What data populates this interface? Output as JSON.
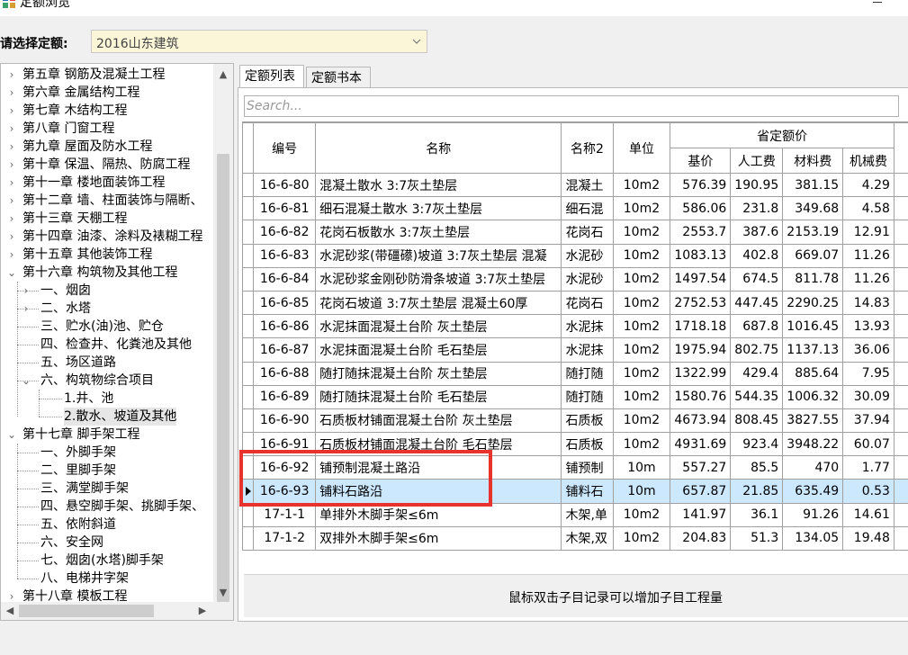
{
  "window": {
    "title": "定额浏览"
  },
  "selector": {
    "label": "请选择定额:",
    "value": "2016山东建筑"
  },
  "tree": [
    {
      "label": "第五章 钢筋及混凝土工程",
      "level": 0,
      "expander": "›"
    },
    {
      "label": "第六章 金属结构工程",
      "level": 0,
      "expander": "›"
    },
    {
      "label": "第七章 木结构工程",
      "level": 0,
      "expander": "›"
    },
    {
      "label": "第八章 门窗工程",
      "level": 0,
      "expander": "›"
    },
    {
      "label": "第九章 屋面及防水工程",
      "level": 0,
      "expander": "›"
    },
    {
      "label": "第十章 保温、隔热、防腐工程",
      "level": 0,
      "expander": "›"
    },
    {
      "label": "第十一章 楼地面装饰工程",
      "level": 0,
      "expander": "›"
    },
    {
      "label": "第十二章 墙、柱面装饰与隔断、",
      "level": 0,
      "expander": "›"
    },
    {
      "label": "第十三章 天棚工程",
      "level": 0,
      "expander": "›"
    },
    {
      "label": "第十四章 油漆、涂料及裱糊工程",
      "level": 0,
      "expander": "›"
    },
    {
      "label": "第十五章 其他装饰工程",
      "level": 0,
      "expander": "›"
    },
    {
      "label": "第十六章 构筑物及其他工程",
      "level": 0,
      "expander": "⌄"
    },
    {
      "label": "一、烟囱",
      "level": 1,
      "expander": "›"
    },
    {
      "label": "二、水塔",
      "level": 1,
      "expander": "›"
    },
    {
      "label": "三、贮水(油)池、贮仓",
      "level": 1,
      "expander": ""
    },
    {
      "label": "四、检查井、化粪池及其他",
      "level": 1,
      "expander": ""
    },
    {
      "label": "五、场区道路",
      "level": 1,
      "expander": ""
    },
    {
      "label": "六、构筑物综合项目",
      "level": 1,
      "expander": "⌄"
    },
    {
      "label": "1.井、池",
      "level": 2,
      "expander": ""
    },
    {
      "label": "2.散水、坡道及其他",
      "level": 2,
      "expander": "",
      "selected": true
    },
    {
      "label": "第十七章 脚手架工程",
      "level": 0,
      "expander": "⌄"
    },
    {
      "label": "一、外脚手架",
      "level": 1,
      "expander": ""
    },
    {
      "label": "二、里脚手架",
      "level": 1,
      "expander": ""
    },
    {
      "label": "三、满堂脚手架",
      "level": 1,
      "expander": ""
    },
    {
      "label": "四、悬空脚手架、挑脚手架、",
      "level": 1,
      "expander": ""
    },
    {
      "label": "五、依附斜道",
      "level": 1,
      "expander": ""
    },
    {
      "label": "六、安全网",
      "level": 1,
      "expander": ""
    },
    {
      "label": "七、烟囱(水塔)脚手架",
      "level": 1,
      "expander": ""
    },
    {
      "label": "八、电梯井字架",
      "level": 1,
      "expander": ""
    },
    {
      "label": "第十八章 模板工程",
      "level": 0,
      "expander": "›"
    }
  ],
  "tabs": [
    {
      "label": "定额列表",
      "active": true
    },
    {
      "label": "定额书本",
      "active": false
    }
  ],
  "search": {
    "placeholder": "Search..."
  },
  "table": {
    "headers": {
      "code": "编号",
      "name": "名称",
      "name2": "名称2",
      "unit": "单位",
      "group": "省定额价",
      "base": "基价",
      "labor": "人工费",
      "material": "材料费",
      "machine": "机械费"
    },
    "rows": [
      {
        "code": "16-6-80",
        "name": "混凝土散水 3:7灰土垫层",
        "name2": "混凝土",
        "unit": "10m2",
        "base": "576.39",
        "labor": "190.95",
        "material": "381.15",
        "machine": "4.29"
      },
      {
        "code": "16-6-81",
        "name": "细石混凝土散水 3:7灰土垫层",
        "name2": "细石混",
        "unit": "10m2",
        "base": "586.06",
        "labor": "231.8",
        "material": "349.68",
        "machine": "4.58"
      },
      {
        "code": "16-6-82",
        "name": "花岗石板散水 3:7灰土垫层",
        "name2": "花岗石",
        "unit": "10m2",
        "base": "2553.7",
        "labor": "387.6",
        "material": "2153.19",
        "machine": "12.91"
      },
      {
        "code": "16-6-83",
        "name": "水泥砂浆(带礓礤)坡道 3:7灰土垫层 混凝",
        "name2": "水泥砂",
        "unit": "10m2",
        "base": "1083.13",
        "labor": "402.8",
        "material": "669.07",
        "machine": "11.26"
      },
      {
        "code": "16-6-84",
        "name": "水泥砂浆金刚砂防滑条坡道 3:7灰土垫层",
        "name2": "水泥砂",
        "unit": "10m2",
        "base": "1497.54",
        "labor": "674.5",
        "material": "811.78",
        "machine": "11.26"
      },
      {
        "code": "16-6-85",
        "name": "花岗石坡道 3:7灰土垫层 混凝土60厚",
        "name2": "花岗石",
        "unit": "10m2",
        "base": "2752.53",
        "labor": "447.45",
        "material": "2290.25",
        "machine": "14.83"
      },
      {
        "code": "16-6-86",
        "name": "水泥抹面混凝土台阶 灰土垫层",
        "name2": "水泥抹",
        "unit": "10m2",
        "base": "1718.18",
        "labor": "687.8",
        "material": "1016.45",
        "machine": "13.93"
      },
      {
        "code": "16-6-87",
        "name": "水泥抹面混凝土台阶 毛石垫层",
        "name2": "水泥抹",
        "unit": "10m2",
        "base": "1975.94",
        "labor": "802.75",
        "material": "1137.13",
        "machine": "36.06"
      },
      {
        "code": "16-6-88",
        "name": "随打随抹混凝土台阶 灰土垫层",
        "name2": "随打随",
        "unit": "10m2",
        "base": "1322.99",
        "labor": "429.4",
        "material": "885.64",
        "machine": "7.95"
      },
      {
        "code": "16-6-89",
        "name": "随打随抹混凝土台阶 毛石垫层",
        "name2": "随打随",
        "unit": "10m2",
        "base": "1580.76",
        "labor": "544.35",
        "material": "1006.32",
        "machine": "30.09"
      },
      {
        "code": "16-6-90",
        "name": "石质板材铺面混凝土台阶 灰土垫层",
        "name2": "石质板",
        "unit": "10m2",
        "base": "4673.94",
        "labor": "808.45",
        "material": "3827.55",
        "machine": "37.94"
      },
      {
        "code": "16-6-91",
        "name": "石质板材铺面混凝土台阶 毛石垫层",
        "name2": "石质板",
        "unit": "10m2",
        "base": "4931.69",
        "labor": "923.4",
        "material": "3948.22",
        "machine": "60.07"
      },
      {
        "code": "16-6-92",
        "name": "铺预制混凝土路沿",
        "name2": "铺预制",
        "unit": "10m",
        "base": "557.27",
        "labor": "85.5",
        "material": "470",
        "machine": "1.77"
      },
      {
        "code": "16-6-93",
        "name": "铺料石路沿",
        "name2": "铺料石",
        "unit": "10m",
        "base": "657.87",
        "labor": "21.85",
        "material": "635.49",
        "machine": "0.53",
        "selected": true
      },
      {
        "code": "17-1-1",
        "name": "单排外木脚手架≤6m",
        "name2": "木架,单",
        "unit": "10m2",
        "base": "141.97",
        "labor": "36.1",
        "material": "91.26",
        "machine": "14.61"
      },
      {
        "code": "17-1-2",
        "name": "双排外木脚手架≤6m",
        "name2": "木架,双",
        "unit": "10m2",
        "base": "204.83",
        "labor": "51.3",
        "material": "134.05",
        "machine": "19.48"
      }
    ]
  },
  "footer": {
    "hint": "鼠标双击子目记录可以增加子目工程量"
  },
  "colors": {
    "highlight": "#e8322c",
    "selected_row": "#cce8ff",
    "combo_bg": "#fbf6d7"
  }
}
